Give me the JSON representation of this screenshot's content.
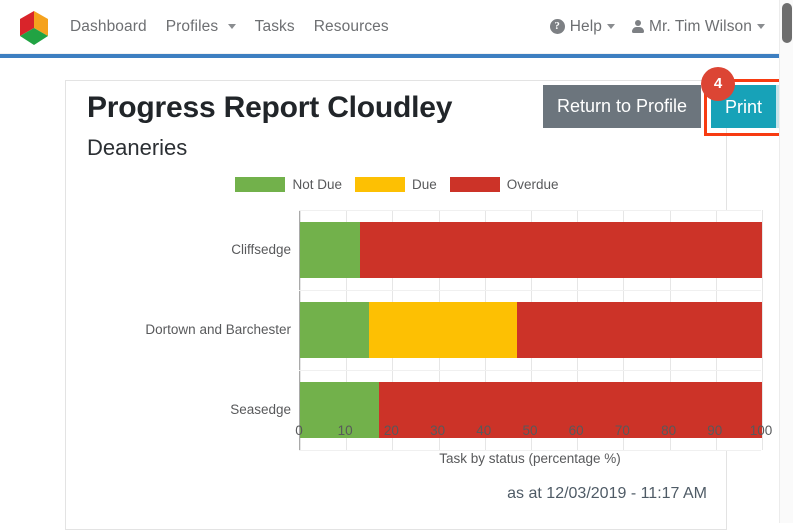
{
  "navbar": {
    "logo_name": "app-logo",
    "links": [
      {
        "label": "Dashboard",
        "has_caret": false
      },
      {
        "label": "Profiles",
        "has_caret": true
      },
      {
        "label": "Tasks",
        "has_caret": false
      },
      {
        "label": "Resources",
        "has_caret": false
      }
    ],
    "help": {
      "label": "Help",
      "icon": "question-circle-icon"
    },
    "user": {
      "label": "Mr. Tim Wilson",
      "icon": "person-icon"
    }
  },
  "card": {
    "title": "Progress Report Cloudley",
    "subtitle": "Deaneries",
    "return_button": "Return to Profile",
    "print_button": "Print",
    "step_badge": "4",
    "as_at": "as at 12/03/2019 - 11:17 AM"
  },
  "colors": {
    "not_due": "#72b14b",
    "due": "#fdc003",
    "overdue": "#cc3328",
    "print_button": "#17a2b8",
    "return_button": "#6c757d",
    "highlight": "#f73b11",
    "badge": "#dc4534",
    "nav_rule": "#3d7fc1"
  },
  "chart_data": {
    "type": "bar",
    "orientation": "horizontal",
    "stacked": true,
    "title": "",
    "xlabel": "Task by status (percentage %)",
    "ylabel": "",
    "xlim": [
      0,
      100
    ],
    "xticks": [
      0,
      10,
      20,
      30,
      40,
      50,
      60,
      70,
      80,
      90,
      100
    ],
    "grid": true,
    "legend_position": "top-center",
    "categories": [
      "Cliffsedge",
      "Dortown and Barchester",
      "Seasedge"
    ],
    "series": [
      {
        "name": "Not Due",
        "color": "#72b14b",
        "values": [
          13,
          15,
          17
        ]
      },
      {
        "name": "Due",
        "color": "#fdc003",
        "values": [
          0,
          32,
          0
        ]
      },
      {
        "name": "Overdue",
        "color": "#cc3328",
        "values": [
          87,
          53,
          83
        ]
      }
    ]
  }
}
